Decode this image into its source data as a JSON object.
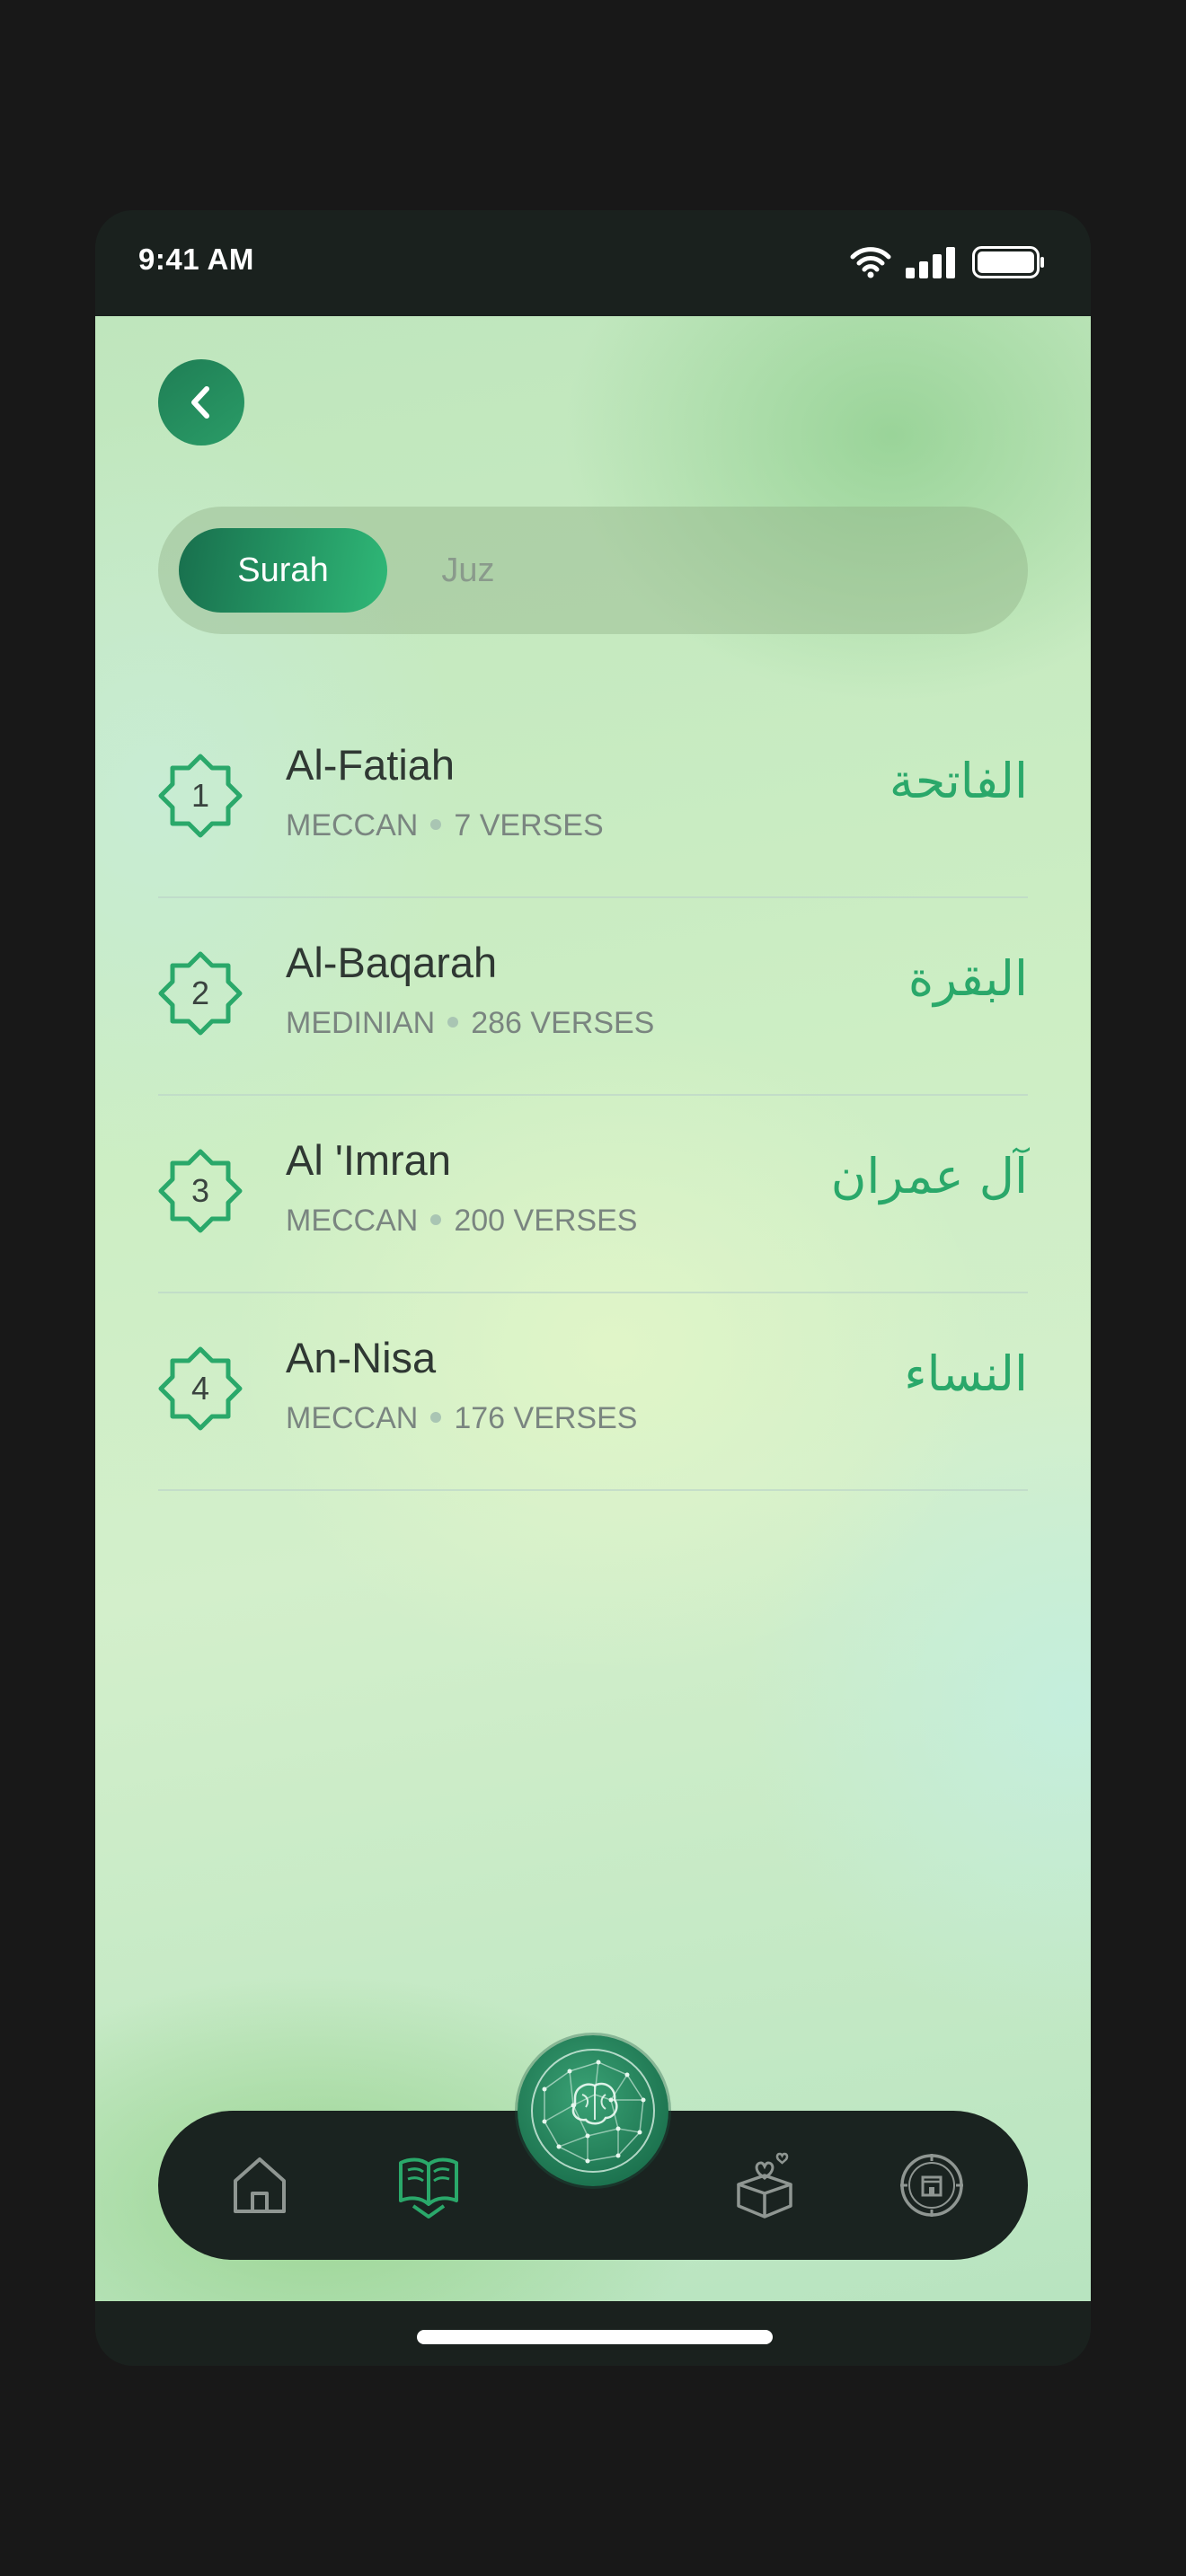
{
  "status_bar": {
    "time": "9:41 AM"
  },
  "header": {
    "back_icon": "chevron-left-icon"
  },
  "segmented_control": {
    "active_tab": "Surah",
    "tabs": [
      {
        "label": "Surah"
      },
      {
        "label": "Juz"
      }
    ]
  },
  "surahs": [
    {
      "number": "1",
      "name": "Al-Fatiah",
      "type": "MECCAN",
      "verses": "7 VERSES",
      "arabic": "الفاتحة"
    },
    {
      "number": "2",
      "name": "Al-Baqarah",
      "type": "MEDINIAN",
      "verses": "286 VERSES",
      "arabic": "البقرة"
    },
    {
      "number": "3",
      "name": "Al 'Imran",
      "type": "MECCAN",
      "verses": "200 VERSES",
      "arabic": "آل عمران"
    },
    {
      "number": "4",
      "name": "An-Nisa",
      "type": "MECCAN",
      "verses": "176 VERSES",
      "arabic": "النساء"
    }
  ],
  "tab_bar": {
    "items": [
      {
        "icon": "home-icon",
        "active": false
      },
      {
        "icon": "quran-book-icon",
        "active": true
      },
      {
        "icon": "globe-brain-icon",
        "active": false
      },
      {
        "icon": "charity-box-icon",
        "active": false
      },
      {
        "icon": "kaaba-compass-icon",
        "active": false
      }
    ]
  },
  "colors": {
    "accent": "#2aa86a",
    "dark": "#1a211e",
    "active_tab_start": "#186f4d",
    "active_tab_end": "#2fb877"
  }
}
